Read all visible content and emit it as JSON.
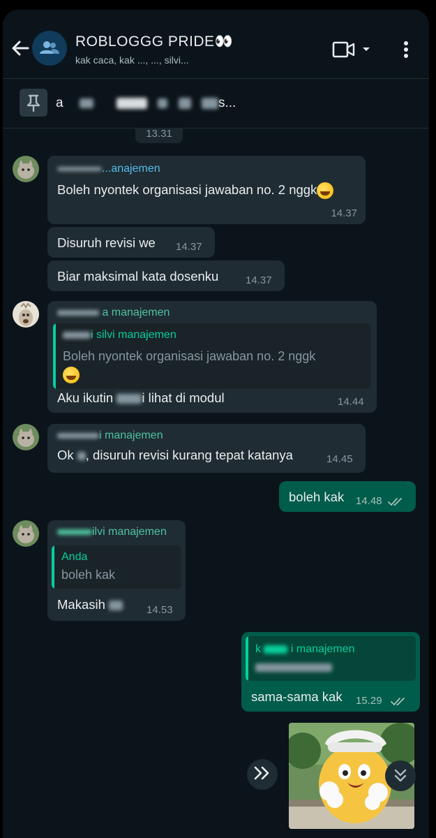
{
  "header": {
    "title": "ROBLOGGG PRIDE",
    "title_emoji": "👀",
    "subtitle": "kak caca, kak ..., ..., silvi..."
  },
  "pinned": {
    "text_start": "a",
    "text_end": "s..."
  },
  "chat": {
    "date_time": "13.31",
    "messages": [
      {
        "sender": "kak silvi manajemen",
        "sender_visible": "...anajemen",
        "text": "Boleh nyontek organisasi jawaban no. 2 nggk",
        "time": "14.37"
      },
      {
        "text": "Disuruh revisi we",
        "time": "14.37"
      },
      {
        "text": "Biar maksimal kata dosenku",
        "time": "14.37"
      },
      {
        "sender_visible": "a manajemen",
        "quote_name": "i silvi manajemen",
        "quote_text": "Boleh nyontek organisasi jawaban no. 2 nggk",
        "text_a": "Aku ikutin",
        "text_b": "i lihat di modul",
        "time": "14.44"
      },
      {
        "sender_visible": "i manajemen",
        "text_a": "Ok",
        "text_b": ", disuruh revisi kurang tepat katanya",
        "time": "14.45"
      },
      {
        "outgoing": true,
        "text": "boleh kak",
        "time": "14.48"
      },
      {
        "sender_visible": "ilvi manajemen",
        "quote_name": "Anda",
        "quote_text": "boleh kak",
        "text": "Makasih",
        "time": "14.53"
      },
      {
        "outgoing": true,
        "quote_name_a": "k",
        "quote_name_b": "i manajemen",
        "text": "sama-sama kak",
        "time": "15.29"
      }
    ]
  },
  "icons": {
    "back": "back-arrow-icon",
    "group": "group-avatar-icon",
    "video": "video-call-icon",
    "menu": "more-vert-icon",
    "pin": "pin-icon",
    "forward": "forward-icon",
    "scroll": "scroll-down-icon"
  },
  "colors": {
    "background": "#0b141a",
    "incoming_bubble": "#202c33",
    "outgoing_bubble": "#005c4b",
    "accent": "#06cf9c"
  }
}
